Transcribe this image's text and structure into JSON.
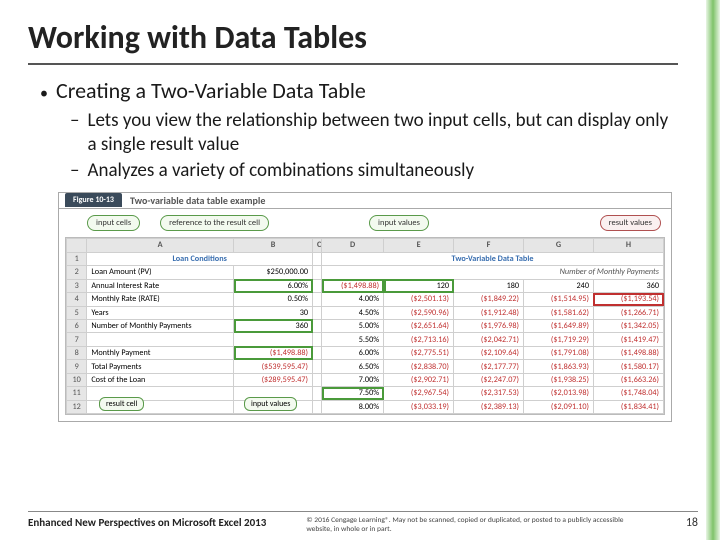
{
  "title": "Working with Data Tables",
  "bullets": {
    "main": "Creating a Two-Variable Data Table",
    "sub1": "Lets you view the relationship between two input cells, but can display only a single result value",
    "sub2": "Analyzes a variety of combinations simultaneously"
  },
  "figure": {
    "tab": "Figure 10-13",
    "caption": "Two-variable data table example",
    "callout_input_cells": "input cells",
    "callout_ref": "reference to the result cell",
    "callout_input_vals": "input values",
    "callout_result_vals": "result values",
    "callout_result_cell": "result cell",
    "section_left": "Loan Conditions",
    "section_right": "Two-Variable Data Table",
    "nmp_label": "Number of Monthly Payments",
    "cols": [
      "A",
      "B",
      "C",
      "D",
      "E",
      "F",
      "G",
      "H"
    ],
    "rows": [
      {
        "n": "2",
        "label": "Loan Amount (PV)",
        "b": "$250,000.00"
      },
      {
        "n": "3",
        "label": "Annual Interest Rate",
        "b": "6.00%",
        "d": "($1,498.88)",
        "e": "120",
        "f": "180",
        "g": "240",
        "h": "360"
      },
      {
        "n": "4",
        "label": "Monthly Rate (RATE)",
        "b": "0.50%",
        "d": "4.00%",
        "e": "($2,501.13)",
        "f": "($1,849.22)",
        "g": "($1,514.95)",
        "h": "($1,193.54)"
      },
      {
        "n": "5",
        "label": "Years",
        "b": "30",
        "d": "4.50%",
        "e": "($2,590.96)",
        "f": "($1,912.48)",
        "g": "($1,581.62)",
        "h": "($1,266.71)"
      },
      {
        "n": "6",
        "label": "Number of Monthly Payments",
        "b": "360",
        "d": "5.00%",
        "e": "($2,651.64)",
        "f": "($1,976.98)",
        "g": "($1,649.89)",
        "h": "($1,342.05)"
      },
      {
        "n": "7",
        "label": "",
        "b": "",
        "d": "5.50%",
        "e": "($2,713.16)",
        "f": "($2,042.71)",
        "g": "($1,719.29)",
        "h": "($1,419.47)"
      },
      {
        "n": "8",
        "label": "Monthly Payment",
        "b": "($1,498.88)",
        "d": "6.00%",
        "e": "($2,775.51)",
        "f": "($2,109.64)",
        "g": "($1,791.08)",
        "h": "($1,498.88)"
      },
      {
        "n": "9",
        "label": "Total Payments",
        "b": "($539,595.47)",
        "d": "6.50%",
        "e": "($2,838.70)",
        "f": "($2,177.77)",
        "g": "($1,863.93)",
        "h": "($1,580.17)"
      },
      {
        "n": "10",
        "label": "Cost of the Loan",
        "b": "($289,595.47)",
        "d": "7.00%",
        "e": "($2,902.71)",
        "f": "($2,247.07)",
        "g": "($1,938.25)",
        "h": "($1,663.26)"
      },
      {
        "n": "11",
        "label": "",
        "b": "",
        "d": "7.50%",
        "e": "($2,967.54)",
        "f": "($2,317.53)",
        "g": "($2,013.98)",
        "h": "($1,748.04)"
      },
      {
        "n": "12",
        "label": "",
        "b": "",
        "d": "8.00%",
        "e": "($3,033.19)",
        "f": "($2,389.13)",
        "g": "($2,091.10)",
        "h": "($1,834.41)"
      }
    ]
  },
  "footer": {
    "left": "Enhanced New Perspectives on Microsoft Excel 2013",
    "copyright": "© 2016 Cengage Learning®. May not be scanned, copied or duplicated, or posted to a publicly accessible website, in whole or in part.",
    "page": "18"
  }
}
